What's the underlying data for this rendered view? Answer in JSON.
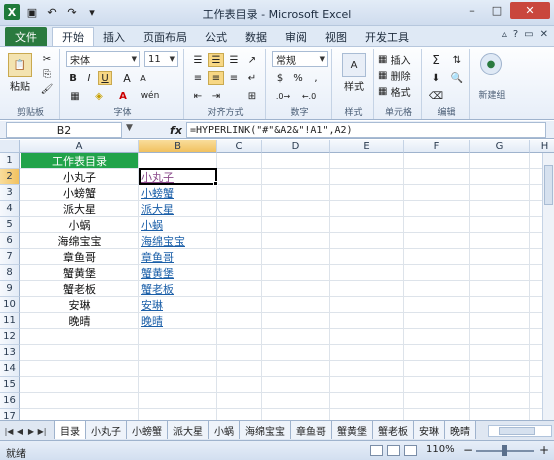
{
  "window": {
    "title": "工作表目录 - Microsoft Excel",
    "minimize": "–",
    "maximize": "□",
    "close": "✕"
  },
  "qat": {
    "app": "X",
    "save": "▣",
    "undo": "↶",
    "redo": "↷",
    "more": "▾"
  },
  "ribbon_tabs": {
    "file": "文件",
    "tabs": [
      "开始",
      "插入",
      "页面布局",
      "公式",
      "数据",
      "审阅",
      "视图",
      "开发工具"
    ],
    "active": "开始",
    "right_icons": [
      "▵",
      "?",
      "▭",
      "✕"
    ]
  },
  "ribbon": {
    "clipboard": {
      "paste": "粘贴",
      "label": "剪贴板"
    },
    "font": {
      "name": "宋体",
      "size": "11",
      "bold": "B",
      "italic": "I",
      "underline": "U",
      "grow": "A",
      "shrink": "A",
      "label": "字体",
      "font_color": "A",
      "wen": "wén"
    },
    "alignment": {
      "label": "对齐方式"
    },
    "number": {
      "format": "常规",
      "label": "数字",
      "percent": "%",
      "comma": ",",
      "currency": "$"
    },
    "styles": {
      "label": "样式",
      "text": "样式"
    },
    "cells": {
      "insert": "插入",
      "delete": "删除",
      "format": "格式",
      "label": "单元格"
    },
    "editing": {
      "label": "编辑",
      "sum": "Σ"
    },
    "newgroup": {
      "label": "新建组"
    }
  },
  "formula_bar": {
    "name_box": "B2",
    "fx": "fx",
    "formula": "=HYPERLINK(\"#\"&A2&\"!A1\",A2)"
  },
  "grid": {
    "columns": [
      "A",
      "B",
      "C",
      "D",
      "E",
      "F",
      "G",
      "H"
    ],
    "rows": [
      "1",
      "2",
      "3",
      "4",
      "5",
      "6",
      "7",
      "8",
      "9",
      "10",
      "11",
      "12",
      "13",
      "14",
      "15",
      "16",
      "17"
    ],
    "header_cell": "工作表目录",
    "col_a": [
      "小丸子",
      "小螃蟹",
      "派大星",
      "小蜗",
      "海绵宝宝",
      "章鱼哥",
      "蟹黄堡",
      "蟹老板",
      "安琳",
      "晚晴"
    ],
    "col_b": [
      "小丸子",
      "小螃蟹",
      "派大星",
      "小蜗",
      "海绵宝宝",
      "章鱼哥",
      "蟹黄堡",
      "蟹老板",
      "安琳",
      "晚晴"
    ]
  },
  "sheet_tabs": [
    "目录",
    "小丸子",
    "小螃蟹",
    "派大星",
    "小蜗",
    "海绵宝宝",
    "章鱼哥",
    "蟹黄堡",
    "蟹老板",
    "安琳",
    "晚晴"
  ],
  "active_sheet": "目录",
  "status": {
    "ready": "就绪",
    "zoom": "110%",
    "zoom_out": "−",
    "zoom_in": "+"
  },
  "colors": {
    "accent_green": "#21a34a",
    "file_tab": "#2a7a3f",
    "link": "#1b5fa8",
    "visited": "#8b4a8b"
  }
}
